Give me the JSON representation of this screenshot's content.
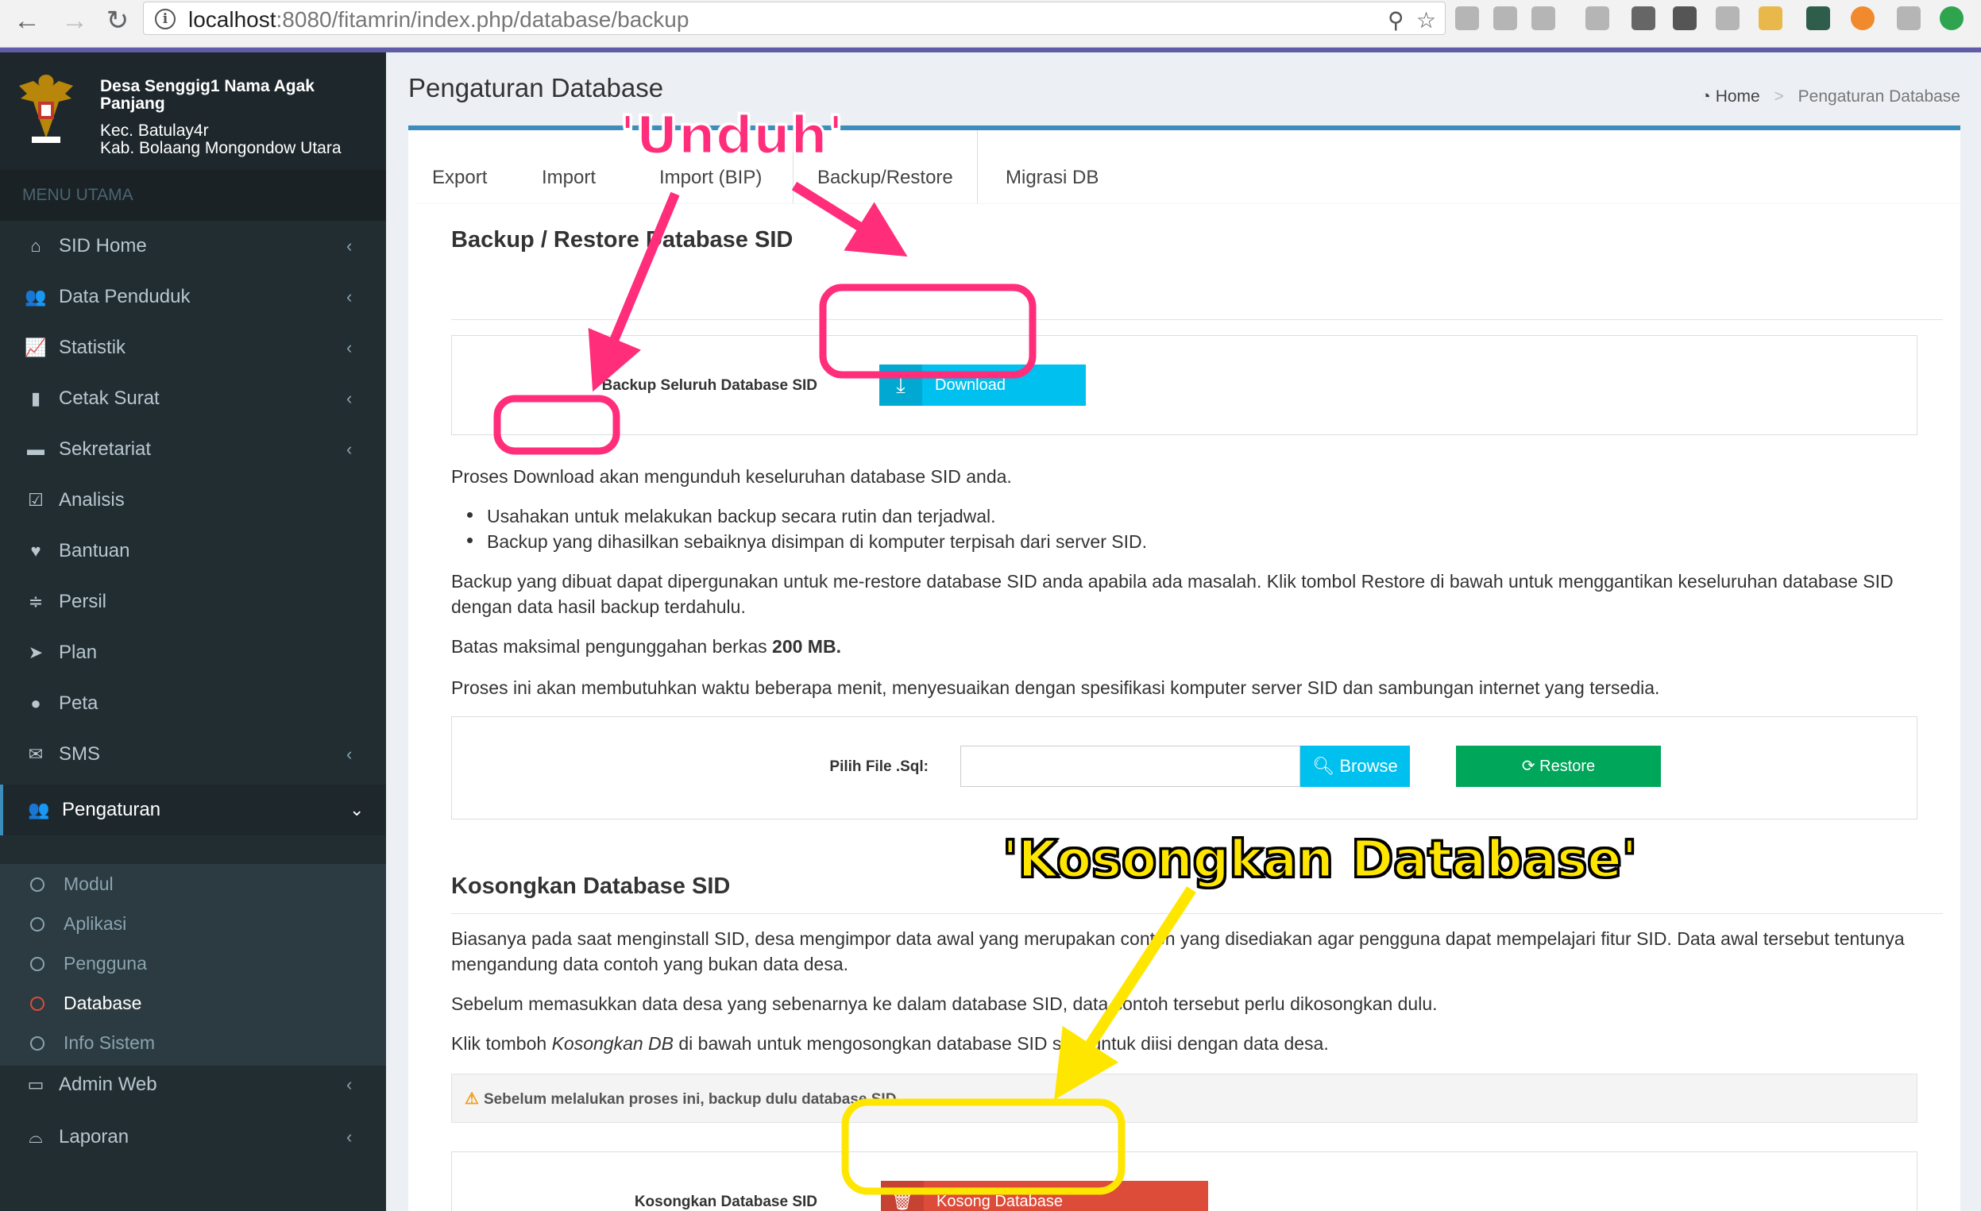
{
  "browser": {
    "url_host": "localhost",
    "url_path": ":8080/fitamrin/index.php/database/backup"
  },
  "sidebar": {
    "village_name": "Desa Senggig1 Nama Agak Panjang",
    "kecamatan": "Kec. Batulay4r",
    "kabupaten": "Kab. Bolaang Mongondow Utara",
    "menu_header": "MENU UTAMA",
    "items": [
      {
        "label": "SID Home",
        "icon": "home-icon"
      },
      {
        "label": "Data Penduduk",
        "icon": "users-icon"
      },
      {
        "label": "Statistik",
        "icon": "line-chart-icon"
      },
      {
        "label": "Cetak Surat",
        "icon": "book-icon"
      },
      {
        "label": "Sekretariat",
        "icon": "archive-icon"
      },
      {
        "label": "Analisis",
        "icon": "check-square-icon"
      },
      {
        "label": "Bantuan",
        "icon": "heart-icon"
      },
      {
        "label": "Persil",
        "icon": "sliders-icon"
      },
      {
        "label": "Plan",
        "icon": "location-arrow-icon"
      },
      {
        "label": "Peta",
        "icon": "globe-icon"
      },
      {
        "label": "SMS",
        "icon": "envelope-icon"
      },
      {
        "label": "Pengaturan",
        "icon": "users-icon"
      },
      {
        "label": "Admin Web",
        "icon": "desktop-icon"
      },
      {
        "label": "Laporan",
        "icon": "hdd-icon"
      }
    ],
    "submenu": [
      {
        "label": "Modul"
      },
      {
        "label": "Aplikasi"
      },
      {
        "label": "Pengguna"
      },
      {
        "label": "Database"
      },
      {
        "label": "Info Sistem"
      }
    ]
  },
  "header": {
    "page_title": "Pengaturan Database",
    "breadcrumb_home": "Home",
    "breadcrumb_current": "Pengaturan Database"
  },
  "tabs": [
    "Export",
    "Import",
    "Import (BIP)",
    "Backup/Restore",
    "Migrasi DB"
  ],
  "backup": {
    "title": "Backup / Restore Database SID",
    "backup_label": "Backup Seluruh Database SID",
    "download_button": "Download",
    "p1": "Proses Download akan mengunduh keseluruhan database SID anda.",
    "bullet1": "Usahakan untuk melakukan backup secara rutin dan terjadwal.",
    "bullet2": "Backup yang dihasilkan sebaiknya disimpan di komputer terpisah dari server SID.",
    "p2": "Backup yang dibuat dapat dipergunakan untuk me-restore database SID anda apabila ada masalah. Klik tombol Restore di bawah untuk menggantikan keseluruhan database SID dengan data hasil backup terdahulu.",
    "p3_prefix": "Batas maksimal pengunggahan berkas ",
    "p3_bold": "200 MB.",
    "p4": "Proses ini akan membutuhkan waktu beberapa menit, menyesuaikan dengan spesifikasi komputer server SID dan sambungan internet yang tersedia.",
    "file_label": "Pilih File .Sql:",
    "browse_button": "Browse",
    "restore_button": "Restore"
  },
  "kosongkan": {
    "title": "Kosongkan Database SID",
    "p1": "Biasanya pada saat menginstall SID, desa mengimpor data awal yang merupakan contoh yang disediakan agar pengguna dapat mempelajari fitur SID. Data awal tersebut tentunya mengandung data contoh yang bukan data desa.",
    "p2": "Sebelum memasukkan data desa yang sebenarnya ke dalam database SID, data contoh tersebut perlu dikosongkan dulu.",
    "p3_prefix": "Klik tomboh ",
    "p3_italic": "Kosongkan DB",
    "p3_suffix": " di bawah untuk mengosongkan database SID siap untuk diisi dengan data desa.",
    "alert": "Sebelum melalukan proses ini, backup dulu database SID.",
    "panel_label": "Kosongkan Database SID",
    "button": "Kosong Database"
  },
  "annotations": {
    "unduh": "'Unduh'",
    "kosongkan": "'Kosongkan Database'",
    "pink": "#ff2d7a",
    "yellow": "#ffe600"
  },
  "colors": {
    "sidebar_bg": "#222d32",
    "accent": "#3c8dbc",
    "info": "#00c0ef",
    "success": "#00a65a",
    "danger": "#dd4b39"
  }
}
